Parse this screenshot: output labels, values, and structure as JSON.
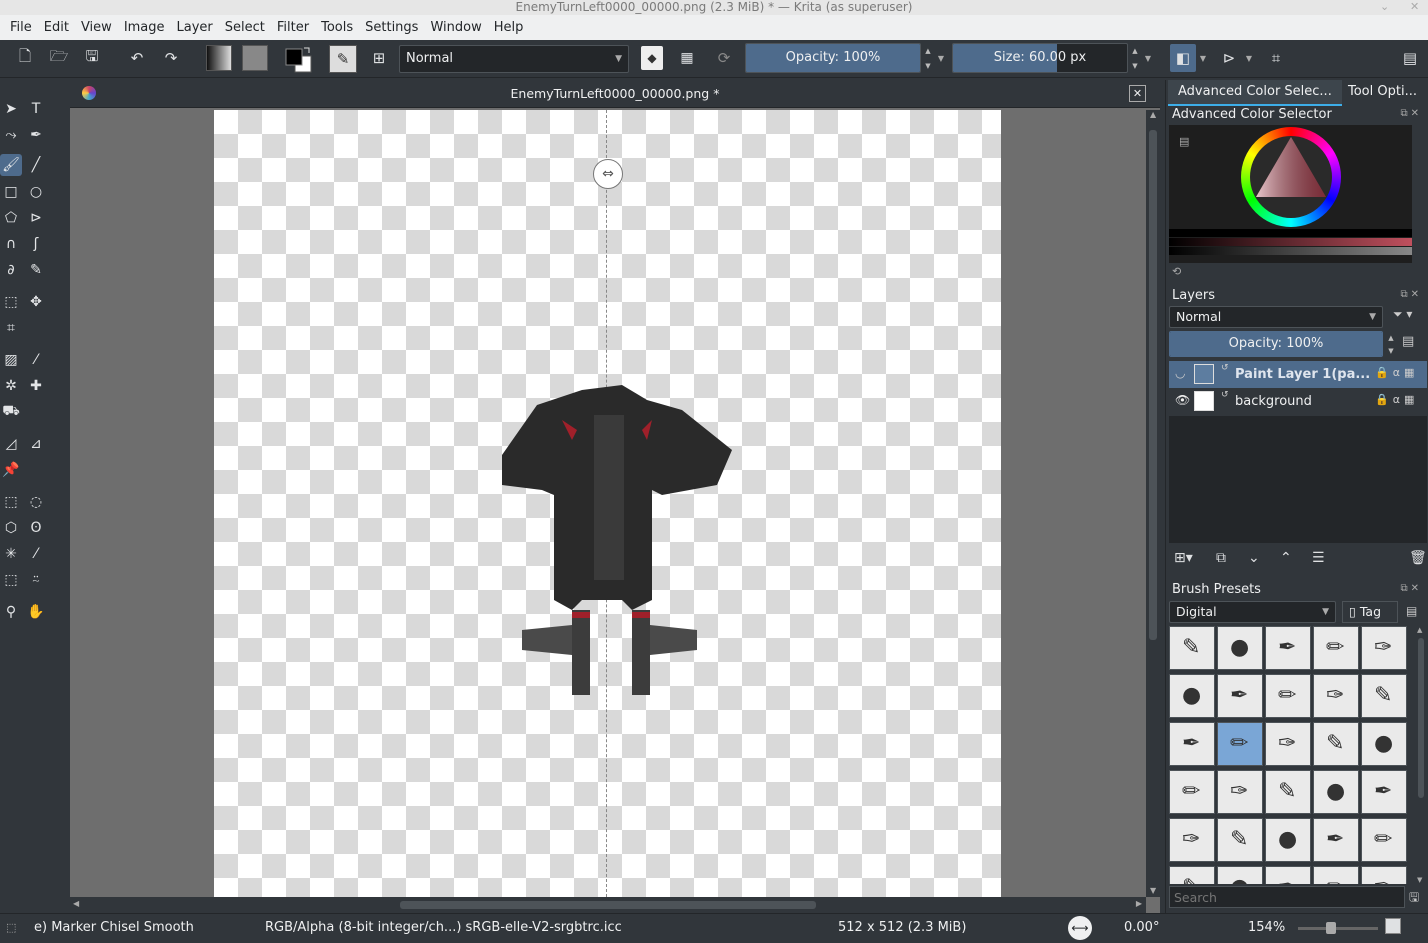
{
  "window": {
    "title": "EnemyTurnLeft0000_00000.png (2.3 MiB)  * — Krita (as superuser)"
  },
  "menu": [
    "File",
    "Edit",
    "View",
    "Image",
    "Layer",
    "Select",
    "Filter",
    "Tools",
    "Settings",
    "Window",
    "Help"
  ],
  "toolbar": {
    "blend_mode": "Normal",
    "opacity_label": "Opacity: 100%",
    "opacity_value": 100,
    "size_label": "Size: 60.00 px",
    "size_fraction": 0.6
  },
  "document": {
    "tab_title": "EnemyTurnLeft0000_00000.png *"
  },
  "dock": {
    "tabs": [
      "Advanced Color Selec...",
      "Tool Opti..."
    ],
    "color_selector": {
      "title": "Advanced Color Selector"
    },
    "layers": {
      "title": "Layers",
      "blend_mode": "Normal",
      "opacity_label": "Opacity:  100%",
      "items": [
        {
          "name": "Paint Layer 1(pa...",
          "selected": true
        },
        {
          "name": "background",
          "selected": false
        }
      ]
    },
    "brush_presets": {
      "title": "Brush Presets",
      "tag_filter": "Digital",
      "tag_label": "Tag",
      "search_placeholder": "Search"
    }
  },
  "status": {
    "brush": "e) Marker Chisel Smooth",
    "color_space": "RGB/Alpha (8-bit integer/ch...)  sRGB-elle-V2-srgbtrc.icc",
    "image_size": "512 x 512 (2.3 MiB)",
    "rotation": "0.00°",
    "zoom": "154%"
  },
  "colors": {
    "accent": "#4e6b8c",
    "panel": "#31363b",
    "canvas_bg": "#6e6e6e"
  }
}
